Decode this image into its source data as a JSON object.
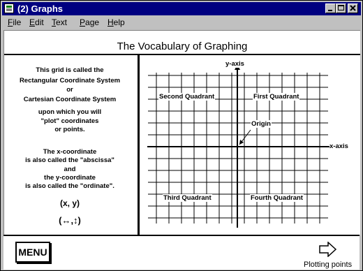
{
  "window": {
    "title": "(2) Graphs"
  },
  "menu": [
    {
      "pre": "",
      "u": "F",
      "post": "ile"
    },
    {
      "pre": "",
      "u": "E",
      "post": "dit"
    },
    {
      "pre": "",
      "u": "T",
      "post": "ext"
    },
    {
      "pre": "",
      "u": "P",
      "post": "age"
    },
    {
      "pre": "",
      "u": "H",
      "post": "elp"
    }
  ],
  "page": {
    "title": "The Vocabulary of Graphing",
    "left_lines": [
      "This grid is called the",
      "Rectangular Coordinate System",
      "or",
      "Cartesian Coordinate System",
      "upon which you will",
      "\"plot\" coordinates",
      "or points.",
      "The x-coordinate",
      "is also called the \"abscissa\"",
      "and",
      "the y-coordinate",
      "is also called the \"ordinate\"."
    ],
    "pair": "(x, y)",
    "pair_arrows": "(↔,↕)"
  },
  "graph": {
    "y_axis_label": "y-axis",
    "x_axis_label": "x-axis",
    "q2": "Second Quadrant",
    "q1": "First Quadrant",
    "q3": "Third Quadrant",
    "q4": "Fourth Quadrant",
    "origin": "Origin"
  },
  "bottom": {
    "menu_button": "MENU",
    "next_label": "Plotting points",
    "next_icon": "right-arrow-icon"
  }
}
